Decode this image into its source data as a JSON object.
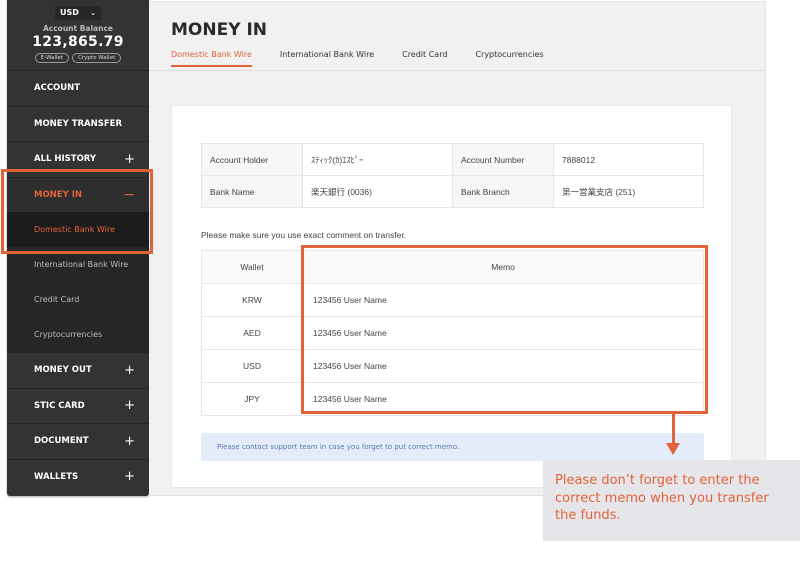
{
  "sidebar": {
    "currency_select": {
      "value": "USD",
      "icon": "chevron-down-icon"
    },
    "balance_label": "Account Balance",
    "balance_value": "123,865.79",
    "wallet_buttons": [
      "E-Wallet",
      "Crypto Wallet"
    ],
    "nav": [
      {
        "label": "ACCOUNT",
        "toggle": ""
      },
      {
        "label": "MONEY TRANSFER",
        "toggle": ""
      },
      {
        "label": "ALL HISTORY",
        "toggle": "+"
      },
      {
        "label": "MONEY IN",
        "toggle": "−"
      },
      {
        "label": "MONEY OUT",
        "toggle": "+"
      },
      {
        "label": "STIC CARD",
        "toggle": "+"
      },
      {
        "label": "DOCUMENT",
        "toggle": "+"
      },
      {
        "label": "WALLETS",
        "toggle": "+"
      }
    ],
    "money_in_sub": [
      "Domestic Bank Wire",
      "International Bank Wire",
      "Credit Card",
      "Cryptocurrencies"
    ]
  },
  "main": {
    "title": "MONEY IN",
    "tabs": [
      "Domestic Bank Wire",
      "International Bank Wire",
      "Credit Card",
      "Cryptocurrencies"
    ],
    "bank_info": {
      "account_holder_label": "Account Holder",
      "account_holder_value": "ｽﾃｨｯｸ(ｶ)ｴｽﾋﾟｰ",
      "account_number_label": "Account Number",
      "account_number_value": "7888012",
      "bank_name_label": "Bank Name",
      "bank_name_value": "楽天銀行 (0036)",
      "bank_branch_label": "Bank Branch",
      "bank_branch_value": "第一営業支店 (251)"
    },
    "comment_notice": "Please make sure you use exact comment on transfer.",
    "memo_table": {
      "headers": [
        "Wallet",
        "Memo"
      ],
      "rows": [
        {
          "wallet": "KRW",
          "memo": "123456 User Name"
        },
        {
          "wallet": "AED",
          "memo": "123456 User Name"
        },
        {
          "wallet": "USD",
          "memo": "123456 User Name"
        },
        {
          "wallet": "JPY",
          "memo": "123456 User Name"
        }
      ]
    },
    "support_info": "Please contact support team in case you forget to put correct memo."
  },
  "annotation": {
    "callout_text": "Please don’t forget to enter the correct memo when you transfer the funds.",
    "accent_color": "#e0633a"
  }
}
